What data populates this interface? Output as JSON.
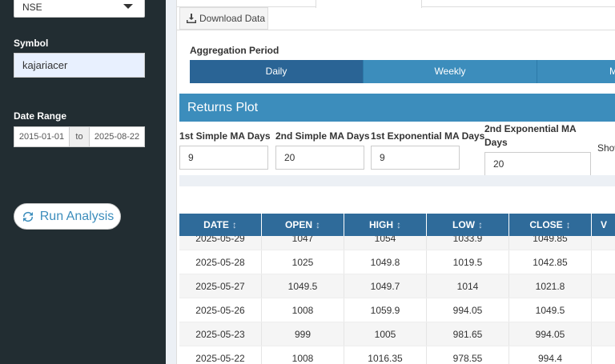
{
  "sidebar": {
    "exchange": "NSE",
    "symbol_label": "Symbol",
    "symbol_value": "kajariacer",
    "date_range_label": "Date Range",
    "date_start": "2015-01-01",
    "date_sep": "to",
    "date_end": "2025-08-22",
    "run_label": "Run Analysis"
  },
  "main": {
    "download_label": "Download Data",
    "aggregation_label": "Aggregation Period",
    "aggregation_options": [
      "Daily",
      "Weekly",
      "M"
    ],
    "aggregation_selected": "Daily",
    "returns_title": "Returns Plot",
    "ma": [
      {
        "label": "1st Simple MA Days",
        "value": "9"
      },
      {
        "label": "2nd Simple MA Days",
        "value": "20"
      },
      {
        "label": "1st Exponential MA Days",
        "value": "9"
      },
      {
        "label": "2nd Exponential MA Days",
        "value": "20"
      }
    ],
    "show_label": "Show"
  },
  "table": {
    "columns": [
      "DATE",
      "OPEN",
      "HIGH",
      "LOW",
      "CLOSE",
      "V"
    ],
    "rows": [
      [
        "2025-05-29",
        "1047",
        "1054",
        "1033.9",
        "1049.85",
        ""
      ],
      [
        "2025-05-28",
        "1025",
        "1049.8",
        "1019.5",
        "1042.85",
        ""
      ],
      [
        "2025-05-27",
        "1049.5",
        "1049.7",
        "1014",
        "1021.8",
        ""
      ],
      [
        "2025-05-26",
        "1008",
        "1059.9",
        "994.05",
        "1049.5",
        ""
      ],
      [
        "2025-05-23",
        "999",
        "1005",
        "981.65",
        "994.05",
        ""
      ],
      [
        "2025-05-22",
        "1008",
        "1016.35",
        "978.55",
        "994.4",
        ""
      ]
    ]
  },
  "colors": {
    "sidebar": "#222d32",
    "primary": "#3c8dbc",
    "primary_dark": "#2a6495",
    "header": "#2f6b9a"
  }
}
